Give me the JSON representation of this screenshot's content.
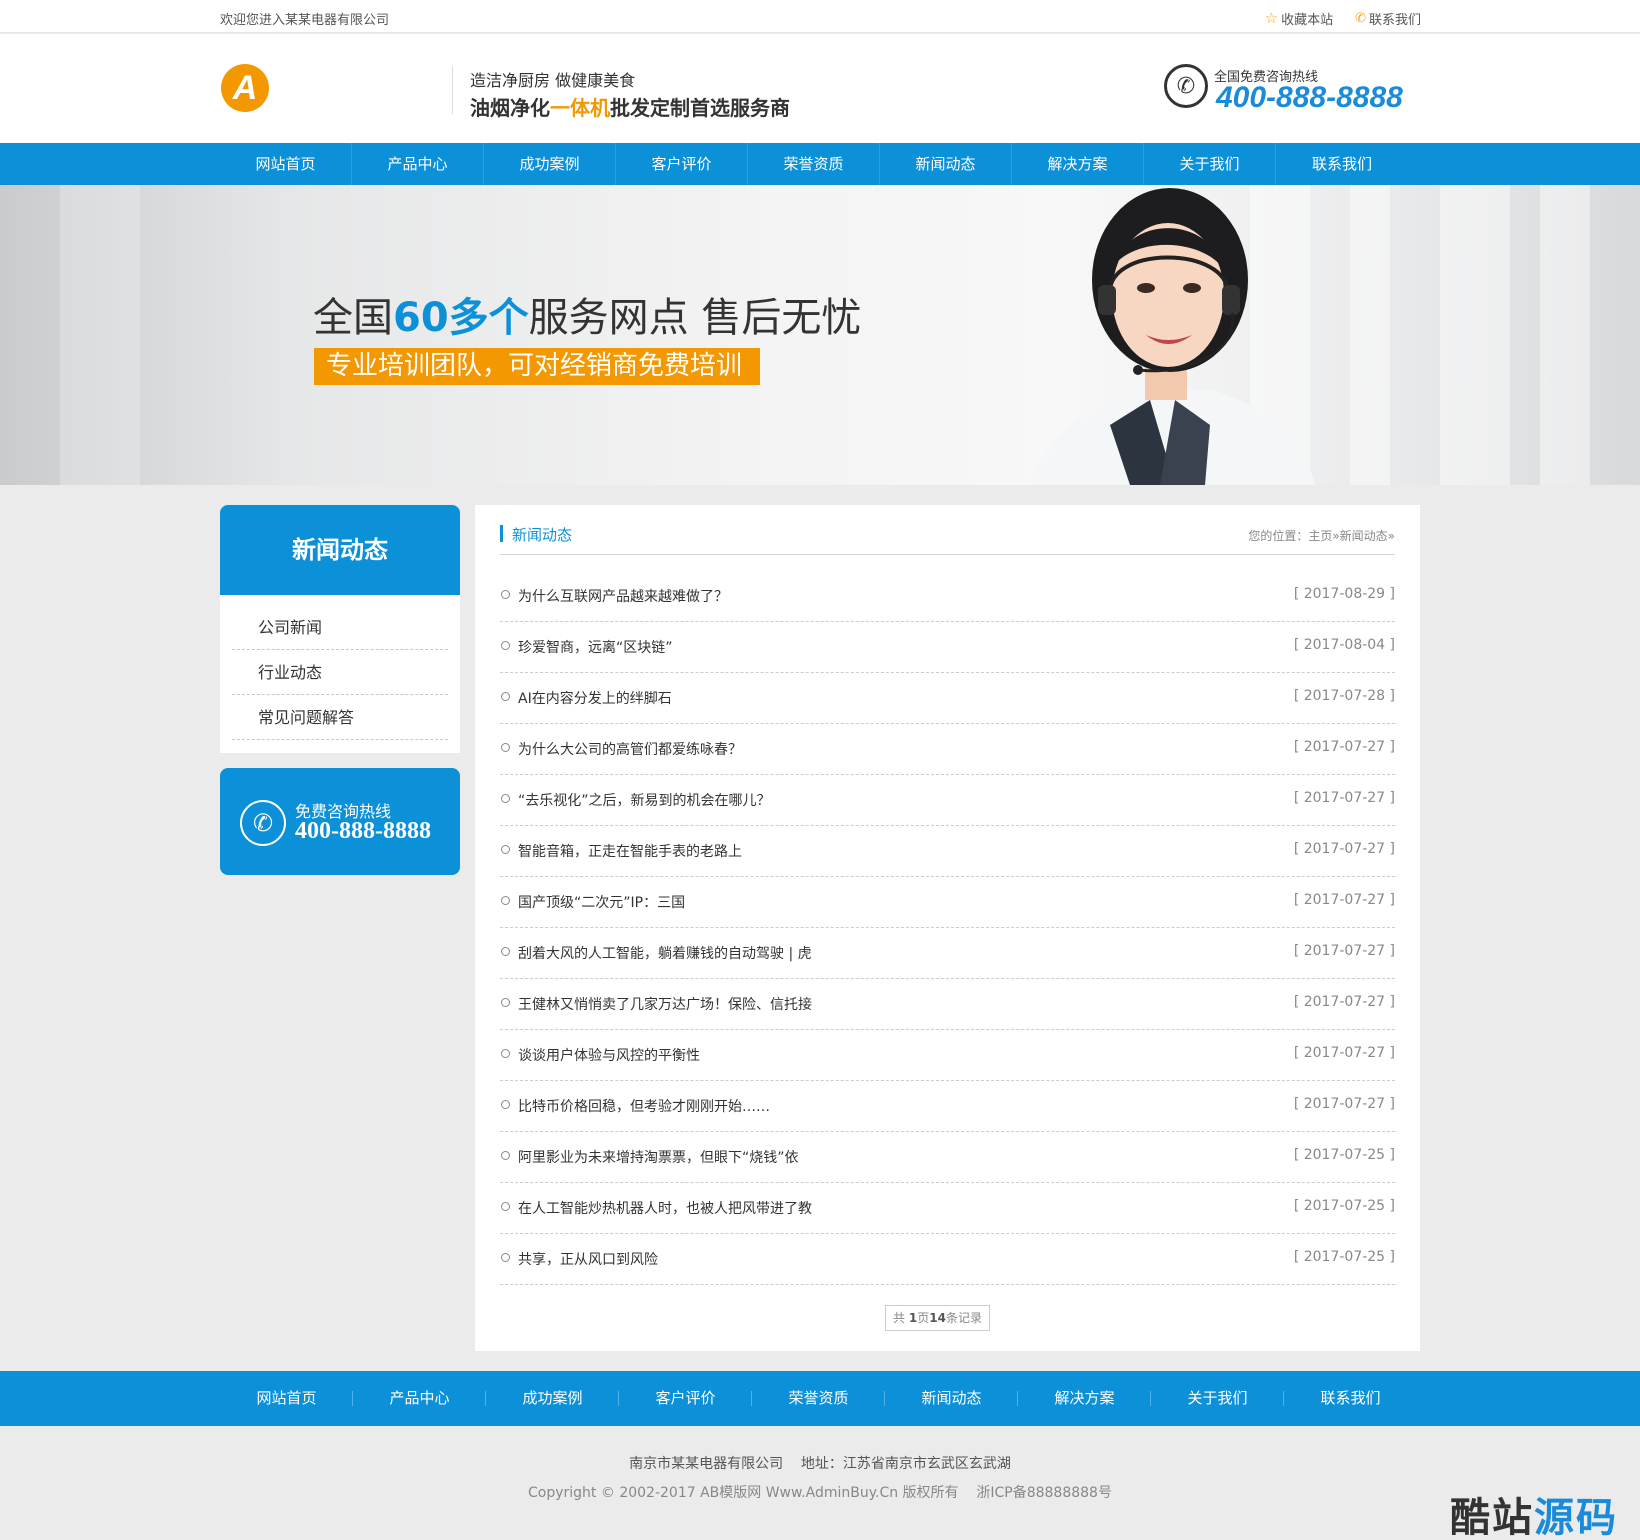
{
  "topbar": {
    "welcome": "欢迎您进入某某电器有限公司",
    "bookmark": "收藏本站",
    "contact": "联系我们"
  },
  "header": {
    "logo_letter": "A",
    "slogan_line1": "造洁净厨房 做健康美食",
    "slogan_line2_a": "油烟净化",
    "slogan_line2_hl": "一体机",
    "slogan_line2_b": "批发定制首选服务商",
    "hotline_label": "全国免费咨询热线",
    "hotline_number": "400-888-8888"
  },
  "nav": [
    "网站首页",
    "产品中心",
    "成功案例",
    "客户评价",
    "荣誉资质",
    "新闻动态",
    "解决方案",
    "关于我们",
    "联系我们"
  ],
  "banner": {
    "title_a": "全国",
    "title_em": "60多个",
    "title_b": "服务网点 售后无忧",
    "subtitle": "专业培训团队，可对经销商免费培训"
  },
  "sidebar": {
    "title": "新闻动态",
    "items": [
      "公司新闻",
      "行业动态",
      "常见问题解答"
    ],
    "contact_label": "免费咨询热线",
    "contact_number": "400-888-8888"
  },
  "main": {
    "section_title": "新闻动态",
    "breadcrumb": "您的位置：主页»新闻动态»",
    "news": [
      {
        "title": "为什么互联网产品越来越难做了？",
        "date": "[ 2017-08-29 ]"
      },
      {
        "title": "珍爱智商，远离“区块链”",
        "date": "[ 2017-08-04 ]"
      },
      {
        "title": "AI在内容分发上的绊脚石",
        "date": "[ 2017-07-28 ]"
      },
      {
        "title": "为什么大公司的高管们都爱练咏春？",
        "date": "[ 2017-07-27 ]"
      },
      {
        "title": "“去乐视化”之后，新易到的机会在哪儿？",
        "date": "[ 2017-07-27 ]"
      },
      {
        "title": "智能音箱，正走在智能手表的老路上",
        "date": "[ 2017-07-27 ]"
      },
      {
        "title": "国产顶级“二次元”IP：三国",
        "date": "[ 2017-07-27 ]"
      },
      {
        "title": "刮着大风的人工智能，躺着赚钱的自动驾驶 | 虎",
        "date": "[ 2017-07-27 ]"
      },
      {
        "title": "王健林又悄悄卖了几家万达广场！保险、信托接",
        "date": "[ 2017-07-27 ]"
      },
      {
        "title": "谈谈用户体验与风控的平衡性",
        "date": "[ 2017-07-27 ]"
      },
      {
        "title": "比特币价格回稳，但考验才刚刚开始……",
        "date": "[ 2017-07-27 ]"
      },
      {
        "title": "阿里影业为未来增持淘票票，但眼下“烧钱”依",
        "date": "[ 2017-07-25 ]"
      },
      {
        "title": "在人工智能炒热机器人时，也被人把风带进了教",
        "date": "[ 2017-07-25 ]"
      },
      {
        "title": "共享，正从风口到风险",
        "date": "[ 2017-07-25 ]"
      }
    ],
    "pager": {
      "prefix": "共 ",
      "pages": "1",
      "mid": "页",
      "records": "14",
      "suffix": "条记录"
    }
  },
  "footer": {
    "nav": [
      "网站首页",
      "产品中心",
      "成功案例",
      "客户评价",
      "荣誉资质",
      "新闻动态",
      "解决方案",
      "关于我们",
      "联系我们"
    ],
    "line1": "南京市某某电器有限公司    地址：江苏省南京市玄武区玄武湖",
    "line2": "Copyright © 2002-2017 AB模版网 Www.AdminBuy.Cn 版权所有    浙ICP备88888888号",
    "watermark_a": "酷站",
    "watermark_b": "源码"
  },
  "colors": {
    "primary": "#0c91d9",
    "accent": "#f39800"
  }
}
